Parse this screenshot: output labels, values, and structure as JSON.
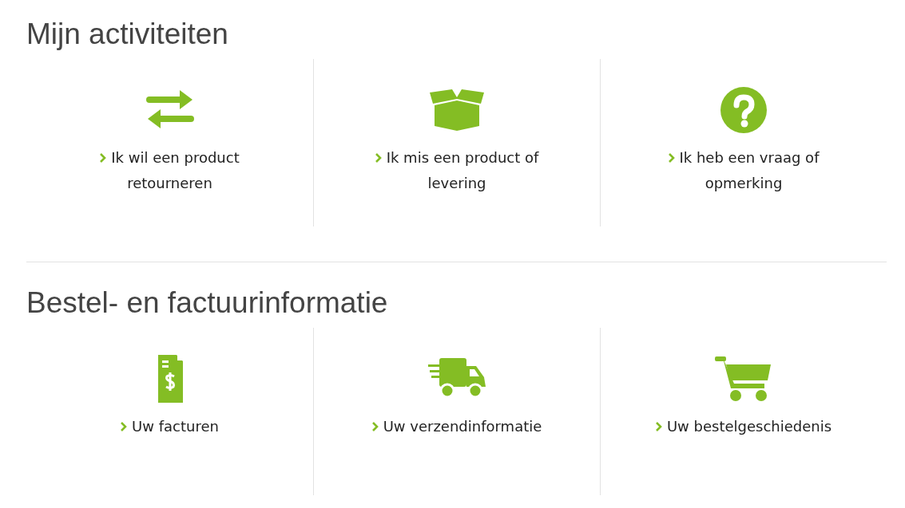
{
  "sections": [
    {
      "title": "Mijn activiteiten",
      "items": [
        {
          "label": "Ik wil een product retourneren"
        },
        {
          "label": "Ik mis een product of levering"
        },
        {
          "label": "Ik heb een vraag of opmerking"
        }
      ]
    },
    {
      "title": "Bestel- en factuurinformatie",
      "items": [
        {
          "label": "Uw facturen"
        },
        {
          "label": "Uw verzendinformatie"
        },
        {
          "label": "Uw bestelgeschiedenis"
        }
      ]
    }
  ]
}
